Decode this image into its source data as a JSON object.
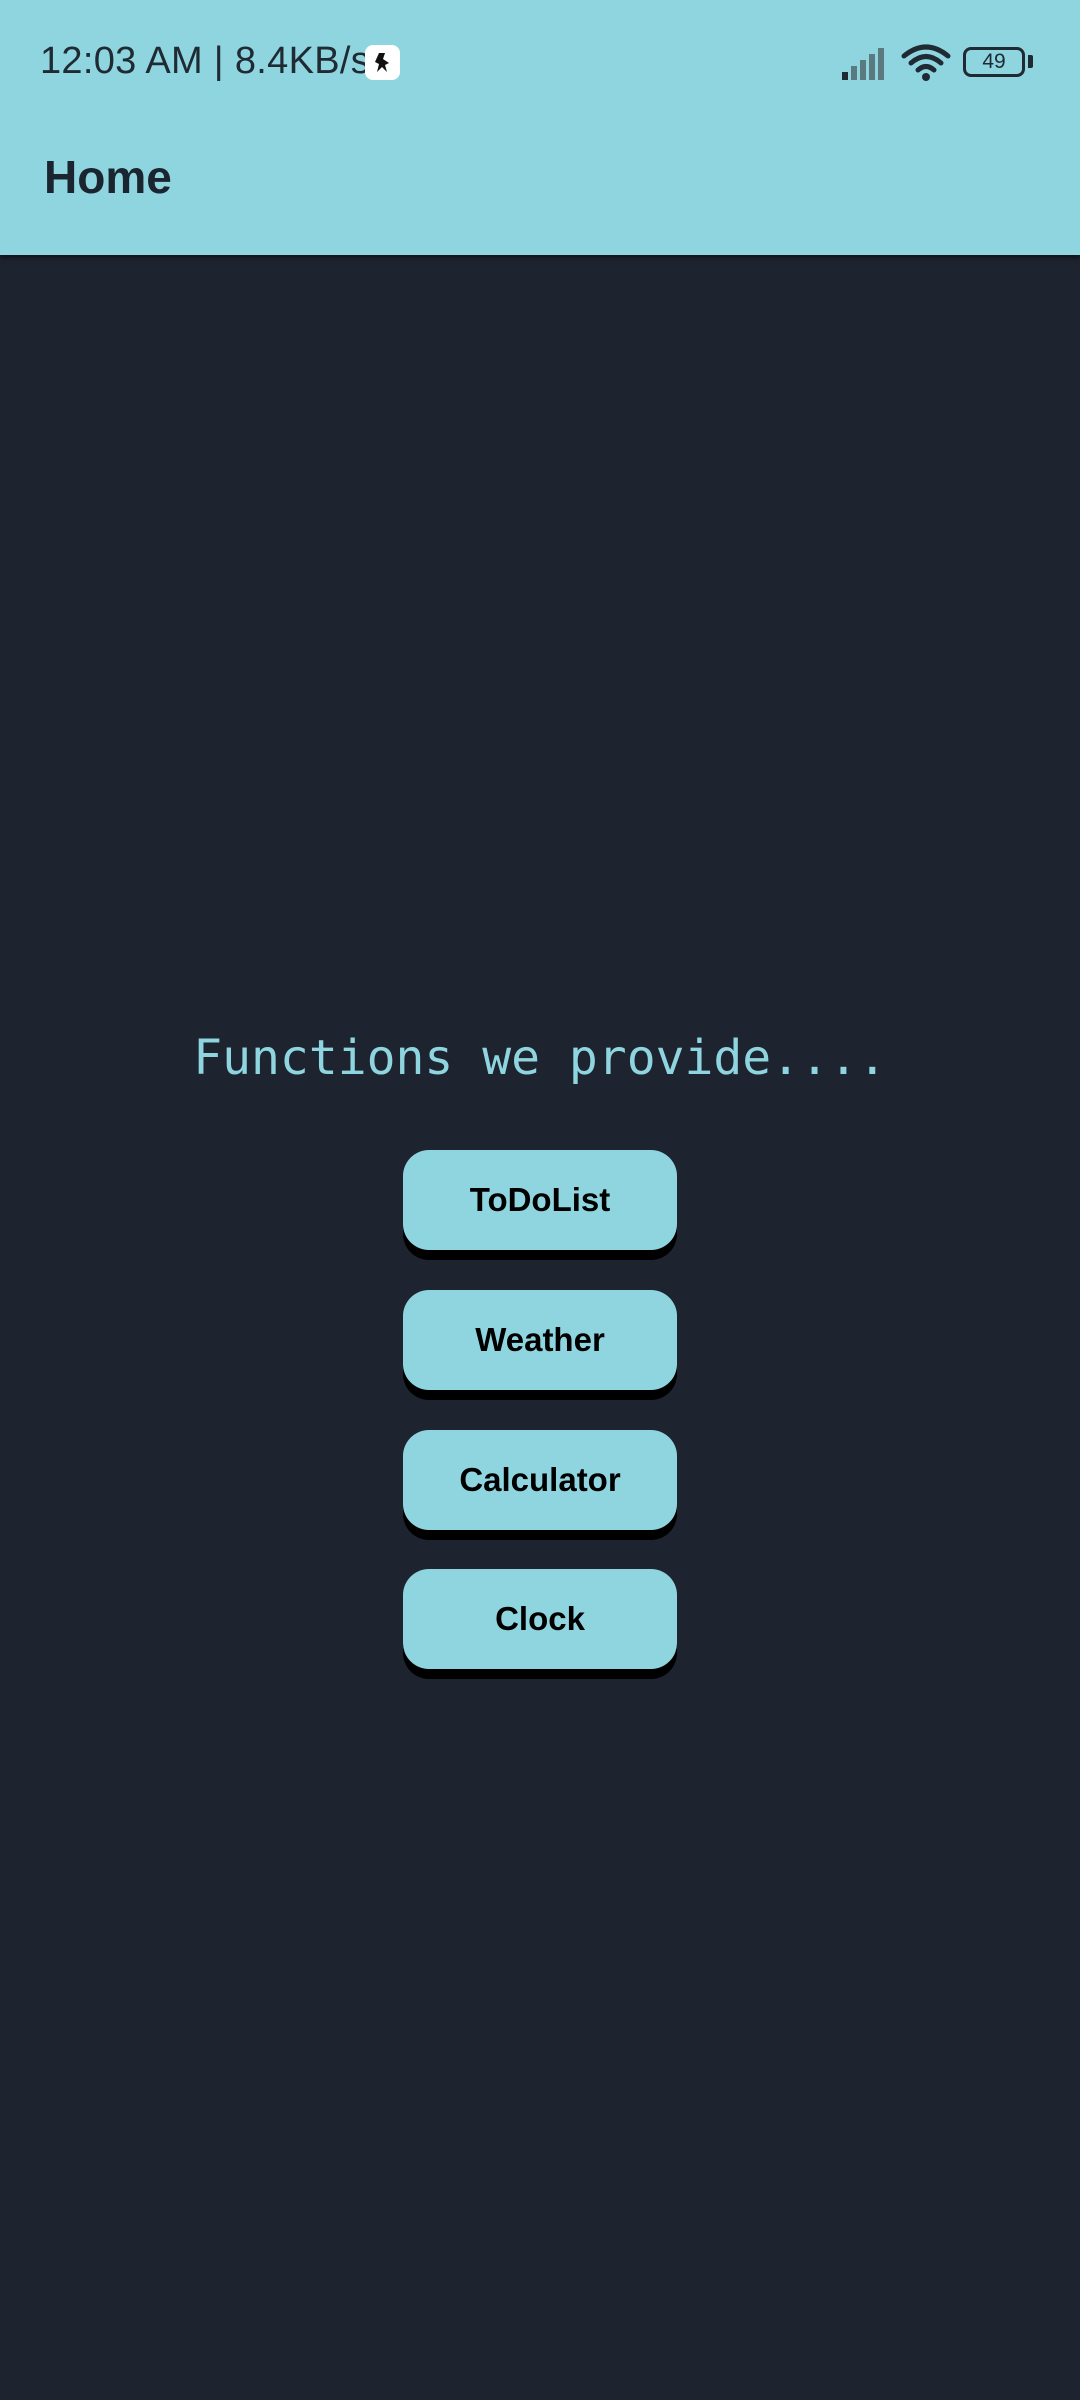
{
  "status_bar": {
    "time_speed": "12:03 AM | 8.4KB/s",
    "battery_level": "49",
    "icons": [
      "notification-app-icon",
      "signal-icon",
      "wifi-icon",
      "battery-icon"
    ]
  },
  "app_bar": {
    "title": "Home"
  },
  "main": {
    "headline": "Functions we provide....",
    "buttons": [
      {
        "label": "ToDoList"
      },
      {
        "label": "Weather"
      },
      {
        "label": "Calculator"
      },
      {
        "label": "Clock"
      }
    ]
  },
  "colors": {
    "accent": "#8fd5df",
    "background": "#1e2330",
    "button_text": "#000000",
    "title_text": "#1a2530"
  }
}
